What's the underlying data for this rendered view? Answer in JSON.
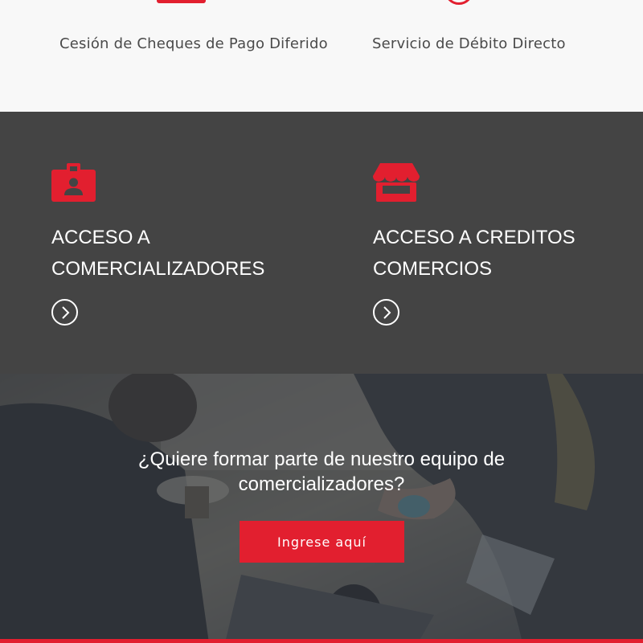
{
  "services": {
    "items": [
      {
        "label": "Cesión de Cheques de Pago Diferido",
        "icon": "cheque-icon"
      },
      {
        "label": "Servicio de Débito Directo",
        "icon": "debit-icon"
      }
    ]
  },
  "access": {
    "items": [
      {
        "title": "ACCESO A COMERCIALIZADORES",
        "icon": "id-badge-icon"
      },
      {
        "title": "ACCESO A CREDITOS COMERCIOS",
        "icon": "store-icon"
      }
    ]
  },
  "join": {
    "question": "¿Quiere formar parte de nuestro equipo de comercializadores?",
    "button_label": "Ingrese aquí"
  },
  "colors": {
    "accent": "#e21f2f",
    "dark_section": "#444444",
    "light_section": "#f8f8f8"
  }
}
